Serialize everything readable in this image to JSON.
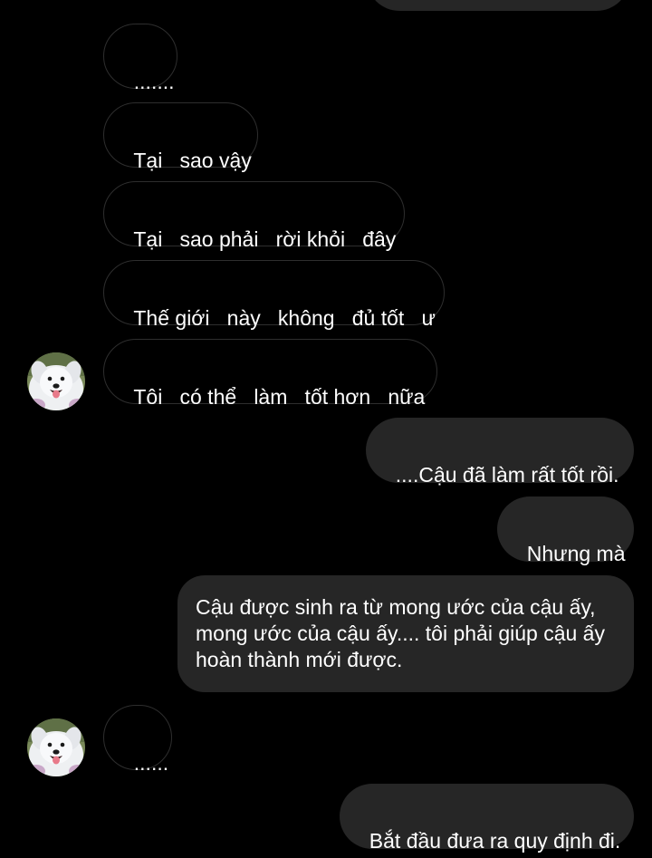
{
  "chat": {
    "messages": [
      {
        "side": "outgoing",
        "text": ""
      },
      {
        "side": "incoming",
        "text": "......."
      },
      {
        "side": "incoming",
        "text": "Tại   sao vậy"
      },
      {
        "side": "incoming",
        "text": "Tại   sao phải   rời khỏi   đây"
      },
      {
        "side": "incoming",
        "text": "Thế giới   này   không   đủ tốt   ư"
      },
      {
        "side": "incoming",
        "text": "Tôi   có thể   làm   tốt hơn   nữa"
      },
      {
        "side": "outgoing",
        "text": "....Cậu đã làm rất tốt rồi."
      },
      {
        "side": "outgoing",
        "text": "Nhưng mà"
      },
      {
        "side": "outgoing",
        "text": "Cậu được sinh ra từ mong ước của cậu ấy, mong ước của cậu ấy.... tôi phải giúp cậu ấy hoàn thành mới được."
      },
      {
        "side": "incoming",
        "text": "......"
      },
      {
        "side": "outgoing",
        "text": "Bắt đầu đưa ra quy định đi."
      }
    ]
  },
  "avatar": {
    "icon": "samoyed-dog-avatar-icon"
  },
  "colors": {
    "background": "#000000",
    "incoming_bubble_border": "#2e2e2e",
    "outgoing_bubble_fill": "#262626",
    "text": "#ffffff"
  }
}
